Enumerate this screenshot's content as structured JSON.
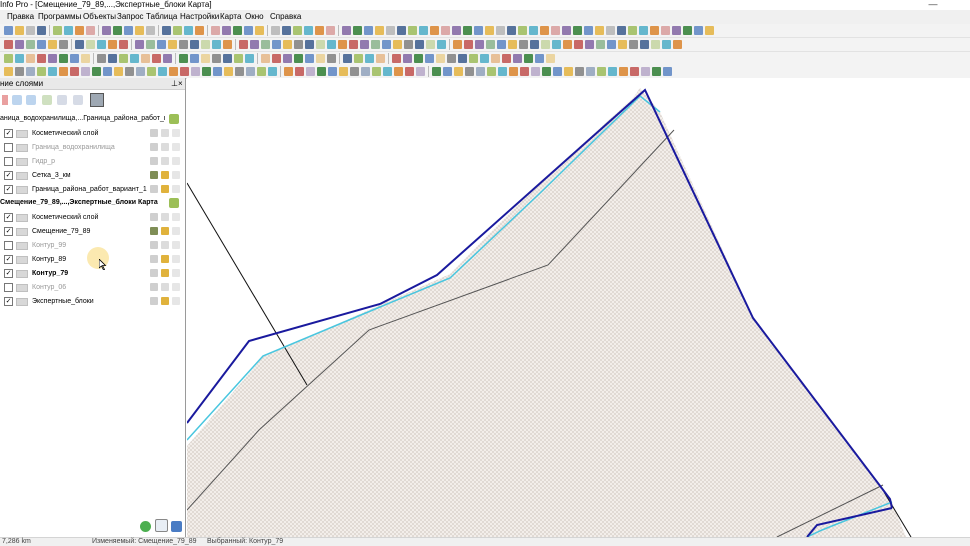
{
  "window": {
    "title": "Info Pro - [Смещение_79_89,...,Экспертные_блоки Карта]",
    "minimize_glyph": "—"
  },
  "menu": [
    "Правка",
    "Программы",
    "Объекты",
    "Запрос",
    "Таблица",
    "Настройки",
    "Карта",
    "Окно",
    "Справка"
  ],
  "layer_panel": {
    "title": "ние слоями",
    "pin_glyph": "⊥",
    "close_glyph": "×",
    "groups": [
      {
        "label": "аница_водохранилища,...Граница_района_работ_вариа",
        "bold": false,
        "layers": [
          {
            "name": "Косметический слой",
            "checked": true,
            "style": "normal",
            "editable": false,
            "selectable": false
          },
          {
            "name": "Граница_водохранилища",
            "checked": false,
            "style": "dim",
            "editable": false,
            "selectable": false
          },
          {
            "name": "Гидр_р",
            "checked": false,
            "style": "dim",
            "editable": false,
            "selectable": false
          },
          {
            "name": "Сетка_3_км",
            "checked": true,
            "style": "normal",
            "editable": true,
            "selectable": true
          },
          {
            "name": "Граница_района_работ_вариант_1",
            "checked": true,
            "style": "normal",
            "editable": false,
            "selectable": true
          }
        ]
      },
      {
        "label": "Смещение_79_89,...,Экспертные_блоки Карта",
        "bold": true,
        "layers": [
          {
            "name": "Косметический слой",
            "checked": true,
            "style": "normal",
            "editable": false,
            "selectable": false
          },
          {
            "name": "Смещение_79_89",
            "checked": true,
            "style": "normal",
            "editable": true,
            "selectable": true
          },
          {
            "name": "Контур_99",
            "checked": false,
            "style": "dim",
            "editable": false,
            "selectable": false
          },
          {
            "name": "Контур_89",
            "checked": true,
            "style": "normal",
            "editable": false,
            "selectable": true
          },
          {
            "name": "Контур_79",
            "checked": true,
            "style": "bold",
            "editable": false,
            "selectable": true
          },
          {
            "name": "Контур_06",
            "checked": false,
            "style": "dim",
            "editable": false,
            "selectable": false
          },
          {
            "name": "Экспертные_блоки",
            "checked": true,
            "style": "normal",
            "editable": false,
            "selectable": true
          }
        ]
      }
    ]
  },
  "status": {
    "scale": "7,286 km",
    "editable": "Изменяемый: Смещение_79_89",
    "selected": "Выбранный: Контур_79"
  },
  "colors": {
    "contour_79": "#1a1a9e",
    "contour_89": "#49c6df",
    "offset_line": "#555555",
    "grid_line": "#111111",
    "hatch": "#cfc5bf",
    "fill": "#f3eeea"
  }
}
